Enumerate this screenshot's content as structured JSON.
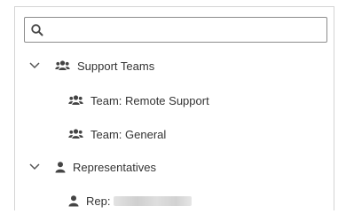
{
  "search": {
    "value": "",
    "placeholder": ""
  },
  "tree": {
    "support_teams": {
      "label": "Support Teams",
      "expanded": true,
      "icon": "users-icon",
      "children": [
        {
          "label": "Team: Remote Support",
          "icon": "users-icon"
        },
        {
          "label": "Team: General",
          "icon": "users-icon"
        }
      ]
    },
    "representatives": {
      "label": "Representatives",
      "expanded": true,
      "icon": "user-icon",
      "children": [
        {
          "label": "Rep:",
          "icon": "user-icon",
          "name_redacted": true
        }
      ]
    }
  },
  "colors": {
    "text": "#333333",
    "icon": "#444444",
    "border": "#d4d4d4",
    "search_border": "#8c8c8c"
  }
}
